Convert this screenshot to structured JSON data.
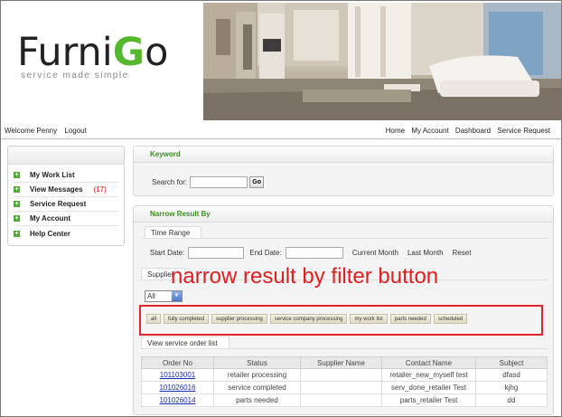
{
  "brand": {
    "name_part1": "Furni",
    "name_g": "G",
    "name_part2": "o",
    "tagline": "service made simple"
  },
  "topnav": {
    "welcome": "Welcome Penny",
    "logout": "Logout",
    "links": [
      "Home",
      "My Account",
      "Dashboard",
      "Service Request"
    ]
  },
  "sidebar": {
    "items": [
      {
        "label": "My Work List",
        "count": ""
      },
      {
        "label": "View Messages",
        "count": "(17)"
      },
      {
        "label": "Service Request",
        "count": ""
      },
      {
        "label": "My Account",
        "count": ""
      },
      {
        "label": "Help Center",
        "count": ""
      }
    ]
  },
  "keyword": {
    "title": "Keyword",
    "search_label": "Search for:",
    "search_value": "",
    "go_label": "Go"
  },
  "narrow": {
    "title": "Narrow Result By",
    "time_range_tab": "Time Range",
    "start_label": "Start Date:",
    "end_label": "End Date:",
    "current_month": "Current Month",
    "last_month": "Last Month",
    "reset": "Reset",
    "supplier_tab": "Supplier",
    "supplier_selected": "All",
    "filters": [
      "all",
      "fully completed",
      "supplier processing",
      "service company processing",
      "my work list",
      "parts needed",
      "scheduled"
    ],
    "list_tab": "View service order list"
  },
  "annotation": {
    "text": "narrow result by filter button",
    "color": "#e02020"
  },
  "orders": {
    "columns": [
      "Order No",
      "Status",
      "Supplier Name",
      "Contact Name",
      "Subject"
    ],
    "rows": [
      {
        "order": "101103001",
        "status": "retailer processing",
        "supplier": "",
        "contact": "retailer_new_myself test",
        "subject": "dfasd"
      },
      {
        "order": "101026016",
        "status": "service completed",
        "supplier": "",
        "contact": "serv_done_retailer Test",
        "subject": "kjhg"
      },
      {
        "order": "101026014",
        "status": "parts needed",
        "supplier": "",
        "contact": "parts_retailer Test",
        "subject": "dd"
      }
    ]
  },
  "colors": {
    "accent_green": "#55b82f",
    "panel_title_green": "#3a8f1a",
    "link_blue": "#1a2fb0",
    "count_red": "#dd0000"
  }
}
